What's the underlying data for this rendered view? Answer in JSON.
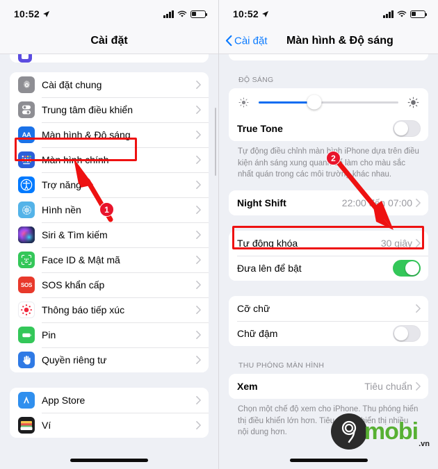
{
  "status_bar": {
    "time": "10:52",
    "location_icon": "location-arrow-icon",
    "signal_icon": "cellular-signal-icon",
    "wifi_icon": "wifi-icon",
    "battery_icon": "battery-low-icon"
  },
  "left_screen": {
    "nav": {
      "title": "Cài đặt"
    },
    "partial_group_top": {
      "rows": [
        {
          "label": "",
          "icon": "purple-app-icon"
        }
      ]
    },
    "main_group": {
      "rows": [
        {
          "label": "Cài đặt chung",
          "icon": "gear-icon",
          "icon_color": "#8e8e93"
        },
        {
          "label": "Trung tâm điều khiển",
          "icon": "control-center-icon",
          "icon_color": "#8e8e93"
        },
        {
          "label": "Màn hình & Độ sáng",
          "icon": "display-brightness-icon",
          "icon_color": "#1b72e8"
        },
        {
          "label": "Màn hình chính",
          "icon": "home-screen-icon",
          "icon_color": "#2b5fd9"
        },
        {
          "label": "Trợ năng",
          "icon": "accessibility-icon",
          "icon_color": "#007aff"
        },
        {
          "label": "Hình nền",
          "icon": "wallpaper-icon",
          "icon_color": "#54b3e8"
        },
        {
          "label": "Siri & Tìm kiếm",
          "icon": "siri-icon",
          "icon_color": "#1c1c2b"
        },
        {
          "label": "Face ID & Mật mã",
          "icon": "face-id-icon",
          "icon_color": "#34c759"
        },
        {
          "label": "SOS khẩn cấp",
          "icon": "sos-icon",
          "icon_color": "#e8392b"
        },
        {
          "label": "Thông báo tiếp xúc",
          "icon": "exposure-notification-icon",
          "icon_color": "#ffffff"
        },
        {
          "label": "Pin",
          "icon": "battery-icon",
          "icon_color": "#34c759"
        },
        {
          "label": "Quyền riêng tư",
          "icon": "privacy-hand-icon",
          "icon_color": "#2f7ae5"
        }
      ]
    },
    "second_group": {
      "rows": [
        {
          "label": "App Store",
          "icon": "app-store-icon",
          "icon_color": "#2f8fee"
        },
        {
          "label": "Ví",
          "icon": "wallet-icon",
          "icon_color": "#1c1c1e"
        }
      ]
    },
    "annotation": {
      "badge": "1",
      "highlight_target": "Màn hình & Độ sáng"
    }
  },
  "right_screen": {
    "nav": {
      "back_label": "Cài đặt",
      "title": "Màn hình & Độ sáng"
    },
    "brightness": {
      "section_header": "ĐỘ SÁNG",
      "slider_value_percent": 40,
      "low_icon": "brightness-low-icon",
      "high_icon": "brightness-high-icon",
      "true_tone": {
        "label": "True Tone",
        "state": "off"
      },
      "footnote": "Tự động điều chỉnh màn hình iPhone dựa trên điều kiện ánh sáng xung quanh để làm cho màu sắc nhất quán trong các môi trường khác nhau.",
      "night_shift": {
        "label": "Night Shift",
        "value": "22:00 đến 07:00"
      }
    },
    "lock_group": {
      "auto_lock": {
        "label": "Tự động khóa",
        "value": "30 giây"
      },
      "raise_to_wake": {
        "label": "Đưa lên để bật",
        "state": "on"
      }
    },
    "text_group": {
      "text_size": {
        "label": "Cỡ chữ"
      },
      "bold_text": {
        "label": "Chữ đậm",
        "state": "off"
      }
    },
    "zoom_group": {
      "section_header": "THU PHÓNG MÀN HÌNH",
      "view": {
        "label": "Xem",
        "value": "Tiêu chuẩn"
      },
      "footnote": "Chọn một chế độ xem cho iPhone. Thu phóng hiển thị điều khiển lớn hơn. Tiêu chuẩn hiển thị nhiều nội dung hơn."
    },
    "annotation": {
      "badge": "2",
      "highlight_target": "Tự động khóa"
    }
  },
  "watermark": {
    "brand": "mobi",
    "tld": ".vn",
    "mark": "9"
  },
  "colors": {
    "accent_blue": "#0a7aff",
    "annotation_red": "#ee1111",
    "toggle_green": "#34c759",
    "slider_blue": "#0a6cf1"
  }
}
